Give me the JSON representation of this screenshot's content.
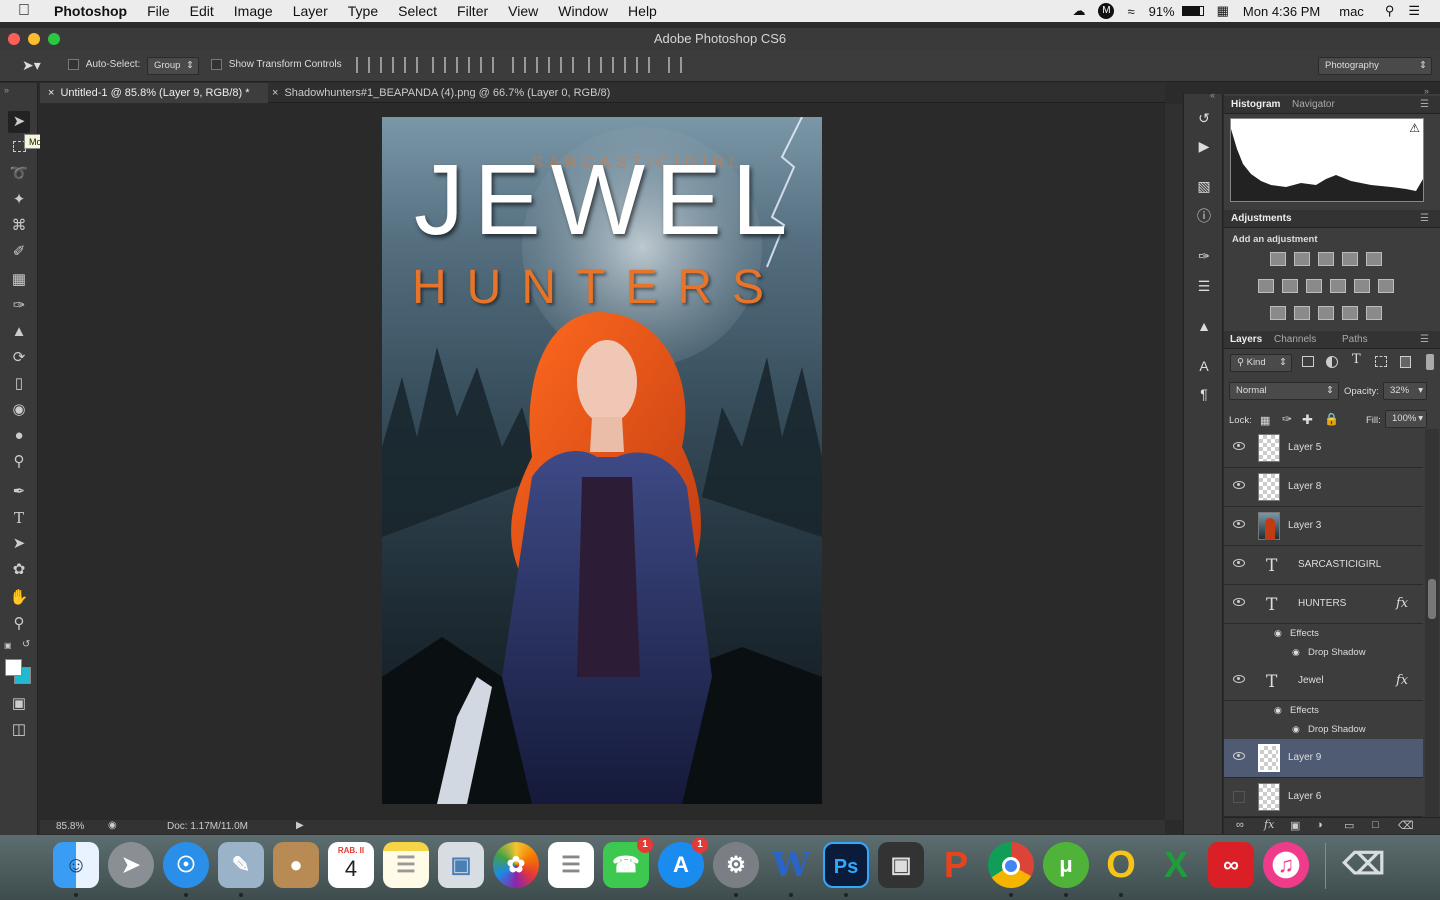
{
  "menubar": {
    "app_name": "Photoshop",
    "items": [
      "File",
      "Edit",
      "Image",
      "Layer",
      "Type",
      "Select",
      "Filter",
      "View",
      "Window",
      "Help"
    ],
    "battery": "91%",
    "datetime": "Mon 4:36 PM",
    "user": "mac"
  },
  "window": {
    "title": "Adobe Photoshop CS6"
  },
  "options_bar": {
    "auto_select_label": "Auto-Select:",
    "auto_select_value": "Group",
    "show_transform_label": "Show Transform Controls",
    "workspace": "Photography"
  },
  "doc_tabs": [
    {
      "label": "Untitled-1 @ 85.8% (Layer 9, RGB/8) *",
      "active": true
    },
    {
      "label": "Shadowhunters#1_BEAPANDA (4).png @ 66.7% (Layer 0, RGB/8)",
      "active": false
    }
  ],
  "tooltip": "Move Tool (V)",
  "artwork": {
    "author": "SARCASTICIGIRL",
    "title_line1": "JEWEL",
    "title_line2": "HUNTERS"
  },
  "status": {
    "zoom": "85.8%",
    "doc_size": "Doc: 1.17M/11.0M"
  },
  "histogram_panel": {
    "tabs": [
      "Histogram",
      "Navigator"
    ]
  },
  "adjustments_panel": {
    "tab": "Adjustments",
    "heading": "Add an adjustment"
  },
  "layers_panel": {
    "tabs": [
      "Layers",
      "Channels",
      "Paths"
    ],
    "filter_kind": "Kind",
    "blend_mode": "Normal",
    "opacity_label": "Opacity:",
    "opacity_value": "32%",
    "lock_label": "Lock:",
    "fill_label": "Fill:",
    "fill_value": "100%",
    "layers": [
      {
        "name": "Layer 5",
        "type": "pixel",
        "visible": true
      },
      {
        "name": "Layer 8",
        "type": "pixel",
        "visible": true
      },
      {
        "name": "Layer 3",
        "type": "pixel",
        "visible": true
      },
      {
        "name": "SARCASTICIGIRL",
        "type": "text",
        "visible": true
      },
      {
        "name": "HUNTERS",
        "type": "text",
        "visible": true,
        "effects_label": "Effects",
        "effect": "Drop Shadow"
      },
      {
        "name": "Jewel",
        "type": "text",
        "visible": true,
        "effects_label": "Effects",
        "effect": "Drop Shadow"
      },
      {
        "name": "Layer 9",
        "type": "pixel",
        "visible": true,
        "selected": true
      },
      {
        "name": "Layer 6",
        "type": "pixel",
        "visible": false
      }
    ]
  },
  "dock": {
    "apps": [
      "Finder",
      "Launchpad",
      "Safari",
      "Preview",
      "Contacts",
      "Calendar",
      "Notes",
      "Image Capture",
      "Photos",
      "Reminders",
      "FaceTime",
      "App Store",
      "System Preferences",
      "Word",
      "Photoshop",
      "Final Cut Pro",
      "WPS Presentation",
      "Chrome",
      "uTorrent",
      "Opera",
      "Excel",
      "Creative Cloud",
      "iTunes",
      "Trash"
    ],
    "calendar_month": "RAB. II",
    "calendar_day": "4",
    "facetime_badge": "1",
    "appstore_badge": "1"
  },
  "colors": {
    "accent_orange": "#e8742a",
    "selected_layer": "#4f5a73",
    "foreground": "#ffffff",
    "background": "#21b8d1"
  }
}
